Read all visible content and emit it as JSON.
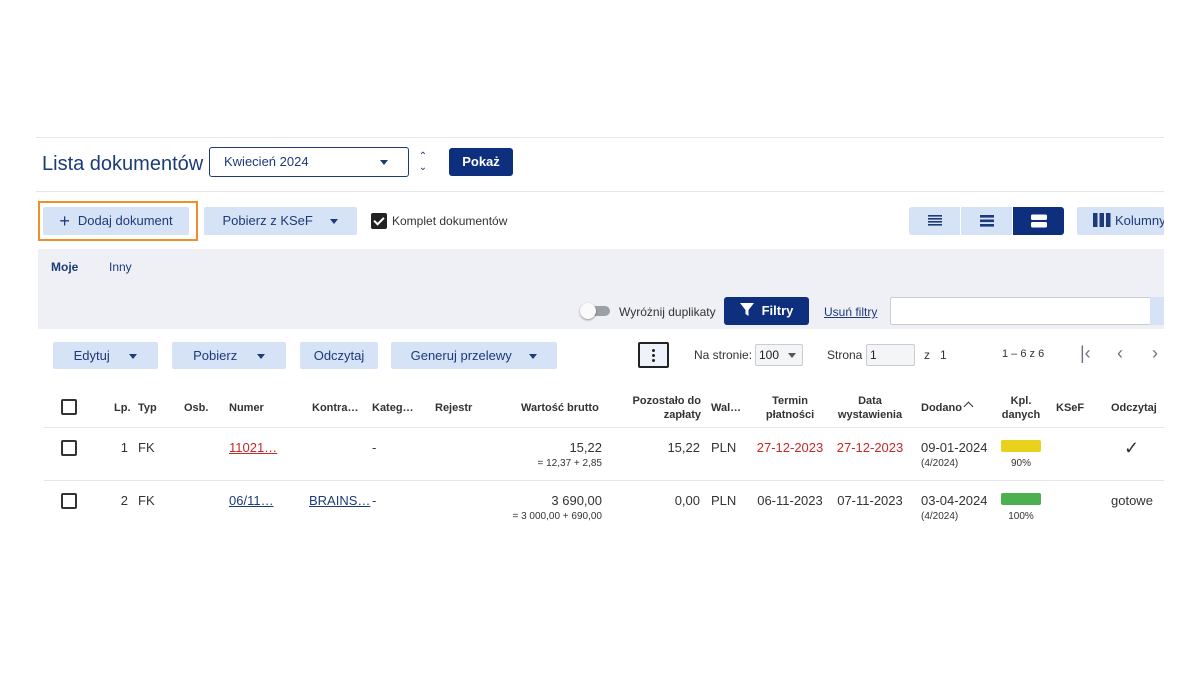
{
  "header": {
    "title": "Lista dokumentów",
    "month_select": "Kwiecień 2024",
    "show_button": "Pokaż"
  },
  "toolbar": {
    "add_document": "Dodaj dokument",
    "fetch_ksef": "Pobierz z KSeF",
    "document_set_label": "Komplet dokumentów",
    "document_set_checked": true,
    "columns_button": "Kolumny"
  },
  "tabs": [
    {
      "label": "Moje",
      "active": true
    },
    {
      "label": "Inny",
      "active": false
    }
  ],
  "filters": {
    "highlight_duplicates": "Wyróżnij duplikaty",
    "filter_button": "Filtry",
    "clear_filters": "Usuń filtry",
    "search_value": ""
  },
  "actions": {
    "edit": "Edytuj",
    "download": "Pobierz",
    "read": "Odczytaj",
    "generate_transfers": "Generuj przelewy"
  },
  "pagination": {
    "per_page_label": "Na stronie:",
    "per_page_value": "100",
    "page_label": "Strona",
    "page_value": "1",
    "of_label": "z",
    "total_pages": "1",
    "range": "1 – 6 z 6"
  },
  "table": {
    "columns": {
      "lp": "Lp.",
      "typ": "Typ",
      "osb": "Osb.",
      "numer": "Numer",
      "kontrahent": "Kontra…",
      "kategoria": "Kateg…",
      "rejestr": "Rejestr",
      "wartosc": "Wartość brutto",
      "pozostalo_1": "Pozostało do",
      "pozostalo_2": "zapłaty",
      "waluta": "Wal…",
      "termin_1": "Termin",
      "termin_2": "płatności",
      "data_1": "Data",
      "data_2": "wystawienia",
      "dodano": "Dodano",
      "kpl_1": "Kpl.",
      "kpl_2": "danych",
      "ksef": "KSeF",
      "odczytaj": "Odczytaj"
    },
    "rows": [
      {
        "lp": "1",
        "typ": "FK",
        "numer": "11021…",
        "kontrahent": "",
        "kategoria": "-",
        "wartosc": "15,22",
        "wartosc_sub": "= 12,37 + 2,85",
        "pozostalo": "15,22",
        "waluta": "PLN",
        "termin": "27-12-2023",
        "data": "27-12-2023",
        "dodano": "09-01-2024",
        "dodano_sub": "(4/2024)",
        "kpl_pct": "90%",
        "kpl_value": 0.9,
        "kpl_color": "#e8d21d",
        "odczytaj": "✓"
      },
      {
        "lp": "2",
        "typ": "FK",
        "numer": "06/11…",
        "kontrahent": "BRAINS…",
        "kategoria": "-",
        "wartosc": "3 690,00",
        "wartosc_sub": "= 3 000,00 + 690,00",
        "pozostalo": "0,00",
        "waluta": "PLN",
        "termin": "06-11-2023",
        "data": "07-11-2023",
        "dodano": "03-04-2024",
        "dodano_sub": "(4/2024)",
        "kpl_pct": "100%",
        "kpl_value": 1.0,
        "kpl_color": "#4caf50",
        "odczytaj": "gotowe"
      }
    ]
  },
  "colors": {
    "primary": "#0d2f7e",
    "light_button": "#d6e3f7",
    "highlight_outline": "#f28d2c",
    "overdue_red": "#c62828"
  }
}
